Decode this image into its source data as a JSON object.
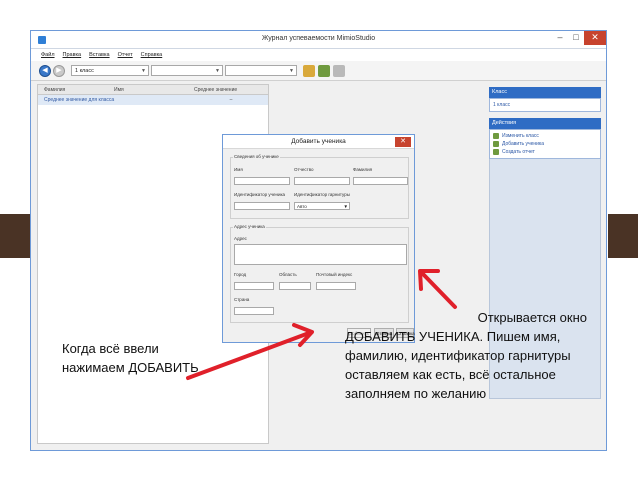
{
  "window": {
    "title": "Журнал успеваемости MimioStudio",
    "minimize": "–",
    "maximize": "□",
    "close": "✕"
  },
  "menu": [
    "Файл",
    "Правка",
    "Вставка",
    "Отчет",
    "Справка"
  ],
  "toolbar": {
    "back": "◀",
    "forward": "▶",
    "class_select": "1 класс"
  },
  "grid": {
    "columns": [
      "Фамилия",
      "Имя",
      "Среднее значение"
    ],
    "row_label": "Среднее значение для класса",
    "row_value": "–"
  },
  "right_panel": {
    "class_header": "Класс",
    "class_item": "1 класс",
    "actions_header": "Действия",
    "actions": [
      "Изменить класс",
      "Добавить ученика",
      "Создать отчет"
    ]
  },
  "dialog": {
    "title": "Добавить ученика",
    "close": "✕",
    "student_section": "Сведения об ученике",
    "first_name": "Имя",
    "patronymic": "Отчество",
    "last_name": "Фамилия",
    "student_id": "Идентификатор ученика",
    "headset_id": "Идентификатор гарнитуры",
    "headset_value": "Авто",
    "address_section": "Адрес ученика",
    "address": "Адрес",
    "city": "Город",
    "region": "Область",
    "postal": "Почтовый индекс",
    "country": "Страна",
    "add_button": "Добавить",
    "cancel_button": "Отмена",
    "help_button": "Справка"
  },
  "annotations": {
    "left": "Когда всё ввели нажимаем ДОБАВИТЬ",
    "right_line1": "Открывается окно",
    "right_rest": "ДОБАВИТЬ УЧЕНИКА. Пишем имя, фамилию, идентификатор гарнитуры оставляем как есть, всё остальное заполняем по желанию"
  },
  "colors": {
    "accent": "#2f6cc4",
    "close_red": "#c7432e",
    "arrow_red": "#e0202a",
    "frame_brown": "#4a3325"
  }
}
